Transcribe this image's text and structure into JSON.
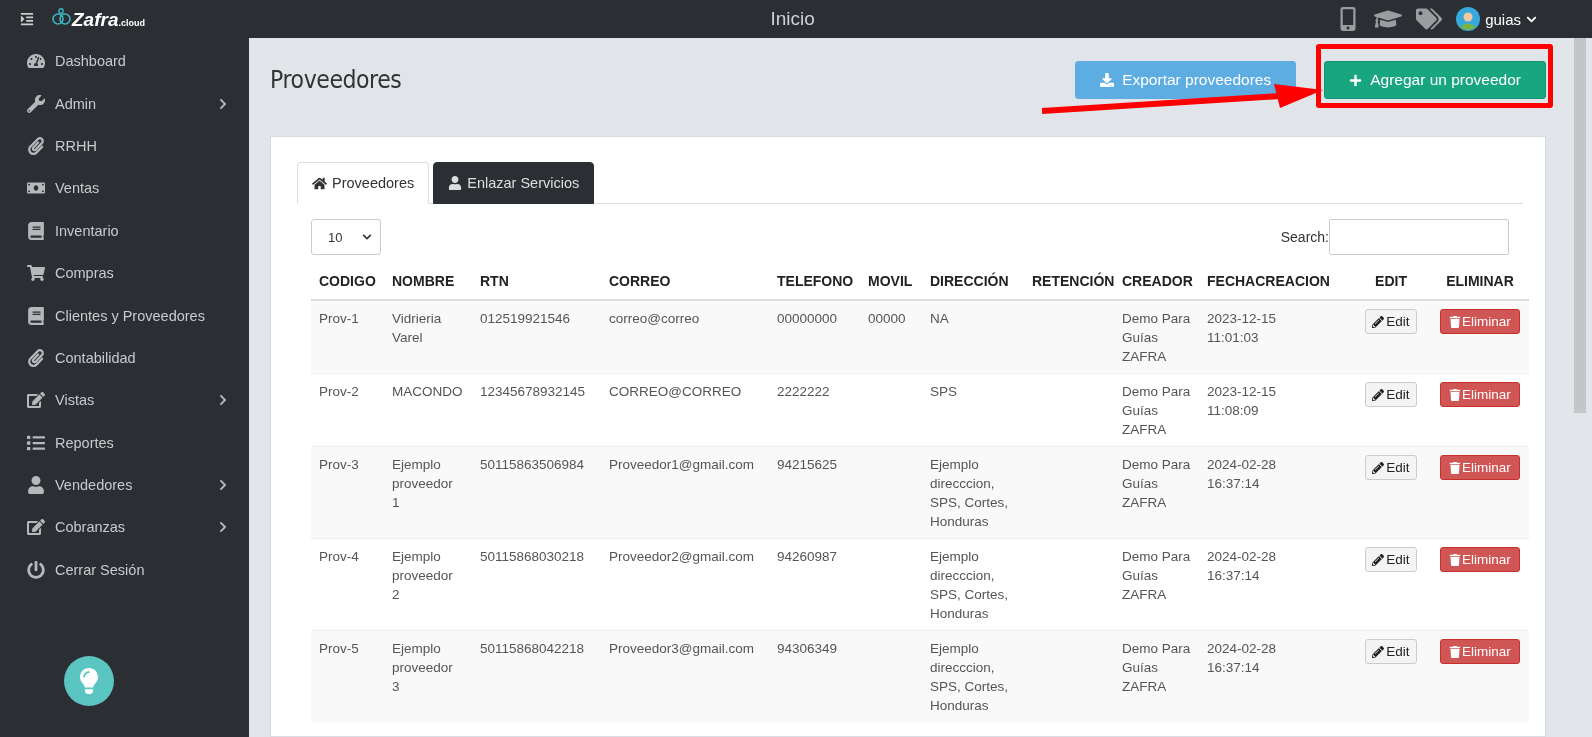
{
  "topbar": {
    "logo": {
      "name": "Zafra",
      "suffix": ".cloud"
    },
    "title": "Inicio",
    "user": "guias"
  },
  "sidebar": {
    "items": [
      {
        "label": "Dashboard",
        "expandable": false
      },
      {
        "label": "Admin",
        "expandable": true
      },
      {
        "label": "RRHH",
        "expandable": false
      },
      {
        "label": "Ventas",
        "expandable": false
      },
      {
        "label": "Inventario",
        "expandable": false
      },
      {
        "label": "Compras",
        "expandable": false
      },
      {
        "label": "Clientes y Proveedores",
        "expandable": false
      },
      {
        "label": "Contabilidad",
        "expandable": false
      },
      {
        "label": "Vistas",
        "expandable": true
      },
      {
        "label": "Reportes",
        "expandable": false
      },
      {
        "label": "Vendedores",
        "expandable": true
      },
      {
        "label": "Cobranzas",
        "expandable": true
      },
      {
        "label": "Cerrar Sesión",
        "expandable": false
      }
    ]
  },
  "page": {
    "title": "Proveedores",
    "buttons": [
      {
        "label": "Exportar proveedores",
        "kind": "export"
      },
      {
        "label": "Agregar un proveedor",
        "kind": "add",
        "highlighted": true
      }
    ]
  },
  "tabs": [
    {
      "label": "Proveedores",
      "selected": true
    },
    {
      "label": "Enlazar Servicios",
      "selected": false
    }
  ],
  "table_controls": {
    "page_length": "10",
    "search_label": "Search:"
  },
  "table": {
    "columns": [
      "CODIGO",
      "NOMBRE",
      "RTN",
      "CORREO",
      "TELEFONO",
      "MOVIL",
      "DIRECCIÓN",
      "RETENCIÓN",
      "CREADOR",
      "FECHACREACION",
      "EDIT",
      "ELIMINAR"
    ],
    "rows": [
      {
        "cells": [
          "Prov-1",
          "Vidrieria Varel",
          "012519921546",
          "correo@correo",
          "00000000",
          "00000",
          "NA",
          "",
          "Demo Para Guías ZAFRA",
          "2023-12-15 11:01:03"
        ],
        "edit": "Edit",
        "delete": "Eliminar"
      },
      {
        "cells": [
          "Prov-2",
          "MACONDO",
          "12345678932145",
          "CORREO@CORREO",
          "2222222",
          "",
          "SPS",
          "",
          "Demo Para Guías ZAFRA",
          "2023-12-15 11:08:09"
        ],
        "edit": "Edit",
        "delete": "Eliminar"
      },
      {
        "cells": [
          "Prov-3",
          "Ejemplo proveedor 1",
          "50115863506984",
          "Proveedor1@gmail.com",
          "94215625",
          "",
          "Ejemplo direcccion, SPS, Cortes, Honduras",
          "",
          "Demo Para Guías ZAFRA",
          "2024-02-28 16:37:14"
        ],
        "edit": "Edit",
        "delete": "Eliminar"
      },
      {
        "cells": [
          "Prov-4",
          "Ejemplo proveedor 2",
          "50115868030218",
          "Proveedor2@gmail.com",
          "94260987",
          "",
          "Ejemplo direcccion, SPS, Cortes, Honduras",
          "",
          "Demo Para Guías ZAFRA",
          "2024-02-28 16:37:14"
        ],
        "edit": "Edit",
        "delete": "Eliminar"
      },
      {
        "cells": [
          "Prov-5",
          "Ejemplo proveedor 3",
          "50115868042218",
          "Proveedor3@gmail.com",
          "94306349",
          "",
          "Ejemplo direcccion, SPS, Cortes, Honduras",
          "",
          "Demo Para Guías ZAFRA",
          "2024-02-28 16:37:14"
        ],
        "edit": "Edit",
        "delete": "Eliminar"
      }
    ]
  }
}
